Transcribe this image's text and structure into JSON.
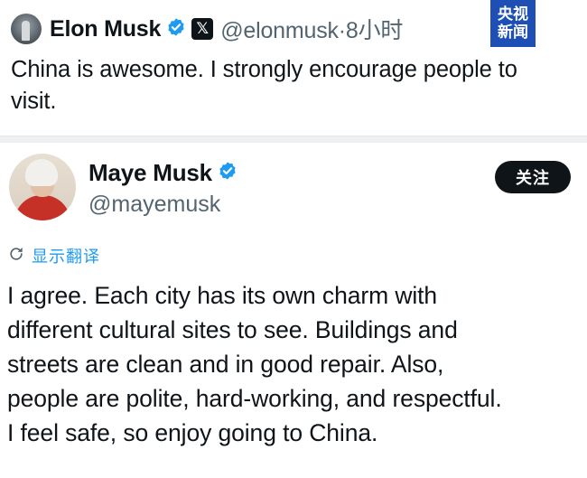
{
  "watermark": {
    "line1": "央视",
    "line2": "新闻"
  },
  "post1": {
    "author_name": "Elon Musk",
    "x_badge": "𝕏",
    "meta": "@elonmusk·8小时",
    "text_lines": [
      "China is awesome. I strongly encourage people to",
      "visit."
    ]
  },
  "post2": {
    "author_name": "Maye Musk",
    "handle": "@mayemusk",
    "follow_label": "关注",
    "translate_label": "显示翻译",
    "text_lines": [
      "I agree. Each city has its own charm with",
      "different cultural sites to see. Buildings and",
      "streets are clean and in good repair. Also,",
      "people are polite, hard-working, and respectful.",
      "I feel safe, so enjoy going to China."
    ]
  },
  "colors": {
    "verified": "#1d9bf0",
    "watermark_bg": "#1e4fb5",
    "secondary_text": "#536471",
    "link": "#1d9bf0"
  }
}
